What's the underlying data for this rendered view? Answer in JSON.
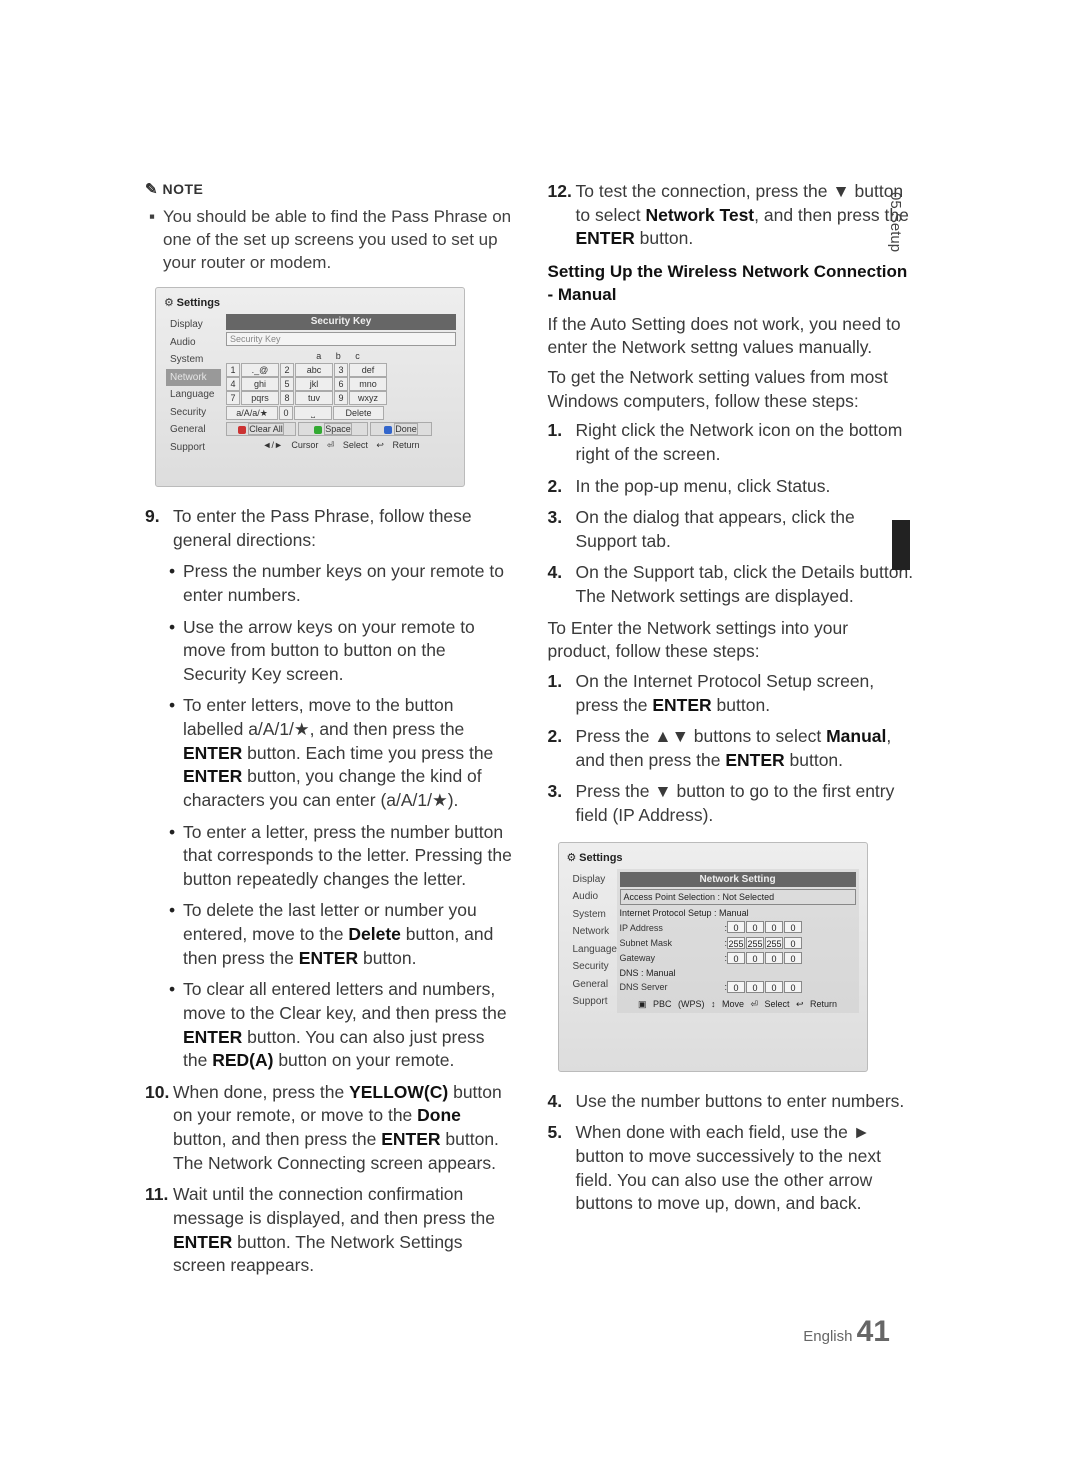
{
  "note": {
    "head": "NOTE",
    "icon": "✎",
    "bullet_sq": "▪",
    "text": "You should be able to find the Pass Phrase on one of the set up screens you used to set up your router or modem."
  },
  "screenshot1": {
    "settings_label": "Settings",
    "side": [
      "Display",
      "Audio",
      "System",
      "Network",
      "Language",
      "Security",
      "General",
      "Support"
    ],
    "active_idx": 3,
    "title": "Security Key",
    "input_placeholder": "Security Key",
    "abc_head": "a   b   c",
    "keys": [
      [
        "1",
        "._@",
        "2",
        "abc",
        "3",
        "def"
      ],
      [
        "4",
        "ghi",
        "5",
        "jkl",
        "6",
        "mno"
      ],
      [
        "7",
        "pqrs",
        "8",
        "tuv",
        "9",
        "wxyz"
      ]
    ],
    "row2": [
      "a/A/a/★",
      "0",
      "⎵",
      "Delete"
    ],
    "row3": {
      "clear": "Clear All",
      "space": "Space",
      "done": "Done"
    },
    "footer": "◄/► Cursor    ⏎ Select    ↩ Return"
  },
  "left_steps": {
    "s9_num": "9.",
    "s9": "To enter the Pass Phrase, follow these general directions:",
    "b1": "Press the number keys on your remote to enter numbers.",
    "b2": "Use the arrow keys on your remote to move from button to button on the Security Key screen.",
    "b3a": "To enter letters, move to the button labelled a/A/1/★, and then press the ",
    "b3b": "ENTER",
    "b3c": " button. Each time you press the ",
    "b3d": "ENTER",
    "b3e": " button, you change the kind of characters you can enter (a/A/1/★).",
    "b4": "To enter a letter, press the number button that corresponds to the letter. Pressing the button repeatedly changes the letter.",
    "b5a": "To delete the last letter or number you entered, move to the ",
    "b5b": "Delete",
    "b5c": " button, and then press the ",
    "b5d": "ENTER",
    "b5e": " button.",
    "b6a": "To clear all entered letters and numbers, move to the Clear key, and then press the ",
    "b6b": "ENTER",
    "b6c": " button. You can also just press the ",
    "b6d": "RED(A)",
    "b6e": " button on your remote.",
    "s10_num": "10.",
    "s10a": "When done, press the ",
    "s10b": "YELLOW(C)",
    "s10c": " button on your remote, or move to the ",
    "s10d": "Done",
    "s10e": " button, and then press the ",
    "s10f": "ENTER",
    "s10g": " button. The Network Connecting screen appears.",
    "s11_num": "11.",
    "s11a": "Wait until the connection confirmation message is displayed, and then press the ",
    "s11b": "ENTER",
    "s11c": " button. The Network Settings screen reappears."
  },
  "right_steps": {
    "s12_num": "12.",
    "s12a": "To test the connection, press the ▼ button to select ",
    "s12b": "Network Test",
    "s12c": ", and then press the ",
    "s12d": "ENTER",
    "s12e": " button.",
    "head": "Setting Up the Wireless Network Connection - Manual",
    "p1": "If the Auto Setting does not work, you need to enter the Network settng values manually.",
    "p2": "To get the Network setting values from most Windows computers, follow these steps:",
    "m1_num": "1.",
    "m1": "Right click the Network icon on the bottom right of the screen.",
    "m2_num": "2.",
    "m2": "In the pop-up menu, click Status.",
    "m3_num": "3.",
    "m3": "On the dialog that appears, click the Support tab.",
    "m4_num": "4.",
    "m4": "On the Support tab, click the Details button. The Network settings are displayed.",
    "p3": "To Enter the Network settings into your product, follow these steps:",
    "e1_num": "1.",
    "e1a": "On the Internet Protocol Setup screen, press the ",
    "e1b": "ENTER",
    "e1c": " button.",
    "e2_num": "2.",
    "e2a": "Press the ▲▼ buttons to select ",
    "e2b": "Manual",
    "e2c": ", and then press the ",
    "e2d": "ENTER",
    "e2e": " button.",
    "e3_num": "3.",
    "e3a": "Press the ▼ button to go to the first entry field (IP Address).",
    "f4_num": "4.",
    "f4": "Use the number buttons to enter numbers.",
    "f5_num": "5.",
    "f5": "When done with each field, use the ► button to move successively to the next field. You can also use the other arrow buttons to move up, down, and back."
  },
  "screenshot2": {
    "settings_label": "Settings",
    "side": [
      "Display",
      "Audio",
      "System",
      "Network",
      "Language",
      "Security",
      "General",
      "Support"
    ],
    "title": "Network Setting",
    "ap_row": "Access Point Selection  : Not Selected",
    "ip_row": "Internet Protocol Setup  : Manual",
    "rows": [
      {
        "lbl": "IP Address",
        "vals": [
          "0",
          "0",
          "0",
          "0"
        ]
      },
      {
        "lbl": "Subnet Mask",
        "vals": [
          "255",
          "255",
          "255",
          "0"
        ]
      },
      {
        "lbl": "Gateway",
        "vals": [
          "0",
          "0",
          "0",
          "0"
        ]
      }
    ],
    "dns_row": "DNS                          : Manual",
    "dns_server": {
      "lbl": "DNS Server",
      "vals": [
        "0",
        "0",
        "0",
        "0"
      ]
    },
    "footer": "▣ PBC (WPS)   ↕ Move   ⏎ Select   ↩ Return"
  },
  "side_tab": "05   Setup",
  "footer": {
    "lang": "English",
    "page": "41"
  }
}
